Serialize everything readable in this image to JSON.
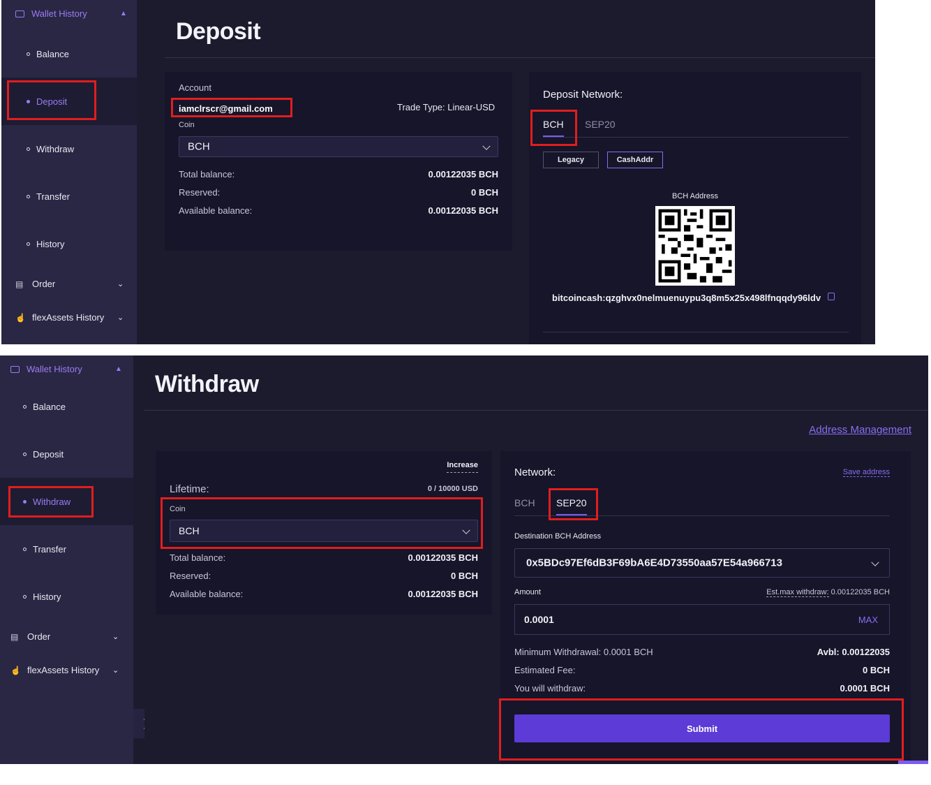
{
  "sidebar": {
    "header": "Wallet History",
    "items": [
      {
        "label": "Balance"
      },
      {
        "label": "Deposit"
      },
      {
        "label": "Withdraw"
      },
      {
        "label": "Transfer"
      },
      {
        "label": "History"
      }
    ],
    "groups": [
      {
        "label": "Order"
      },
      {
        "label": "flexAssets History"
      }
    ]
  },
  "deposit": {
    "title": "Deposit",
    "account_label": "Account",
    "account_value": "iamclrscr@gmail.com",
    "trade_type": "Trade Type: Linear-USD",
    "coin_label": "Coin",
    "coin_value": "BCH",
    "total_balance_label": "Total balance:",
    "total_balance_value": "0.00122035 BCH",
    "reserved_label": "Reserved:",
    "reserved_value": "0 BCH",
    "available_label": "Available balance:",
    "available_value": "0.00122035 BCH",
    "network_label": "Deposit Network:",
    "network_tabs": [
      "BCH",
      "SEP20"
    ],
    "format_buttons": [
      "Legacy",
      "CashAddr"
    ],
    "address_label": "BCH Address",
    "address_value": "bitcoincash:qzghvx0nelmuenuypu3q8m5x25x498lfnqqdy96ldv"
  },
  "withdraw": {
    "title": "Withdraw",
    "address_management": "Address Management",
    "increase_label": "Increase",
    "lifetime_label": "Lifetime:",
    "lifetime_value": "0 / 10000 USD",
    "coin_label": "Coin",
    "coin_value": "BCH",
    "total_balance_label": "Total balance:",
    "total_balance_value": "0.00122035 BCH",
    "reserved_label": "Reserved:",
    "reserved_value": "0 BCH",
    "available_label": "Available balance:",
    "available_value": "0.00122035 BCH",
    "network_label": "Network:",
    "save_address": "Save address",
    "network_tabs": [
      "BCH",
      "SEP20"
    ],
    "destination_label": "Destination BCH Address",
    "destination_value": "0x5BDc97Ef6dB3F69bA6E4D73550aa57E54a966713",
    "amount_label": "Amount",
    "est_max_label": "Est.max withdraw:",
    "est_max_value": "0.00122035 BCH",
    "amount_value": "0.0001",
    "max_label": "MAX",
    "min_withdrawal": "Minimum Withdrawal: 0.0001 BCH",
    "avbl": "Avbl: 0.00122035",
    "fee_label": "Estimated Fee:",
    "fee_value": "0 BCH",
    "you_withdraw_label": "You will withdraw:",
    "you_withdraw_value": "0.0001 BCH",
    "submit": "Submit"
  },
  "colors": {
    "accent": "#7b5cf0",
    "highlight": "#e01e1e",
    "bg": "#1c1b2e",
    "sidebar": "#2a2745"
  }
}
